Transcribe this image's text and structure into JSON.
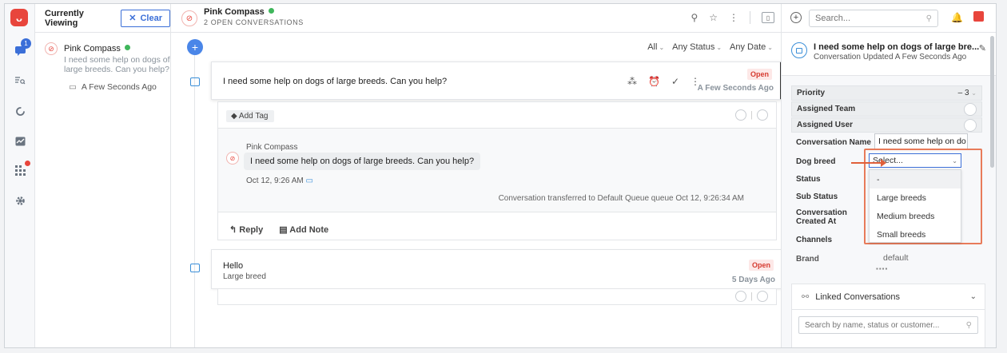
{
  "rail": {
    "badge_count": "1"
  },
  "viewing": {
    "title": "Currently Viewing",
    "clear_label": "Clear",
    "item": {
      "name": "Pink Compass",
      "preview": "I need some help on dogs of large breeds. Can you help?",
      "time": "A Few Seconds Ago"
    }
  },
  "center": {
    "title": "Pink Compass",
    "subtitle": "2 OPEN CONVERSATIONS",
    "filters": [
      "All",
      "Any Status",
      "Any Date"
    ],
    "conversation1": {
      "text": "I need some help on dogs of large breeds. Can you help?",
      "status": "Open",
      "time": "A Few Seconds Ago",
      "tag_label": "Add Tag",
      "sender": "Pink Compass",
      "message": "I need some help on dogs of large breeds. Can you help?",
      "message_time": "Oct 12, 9:26 AM",
      "transfer_note": "Conversation transferred to Default Queue queue Oct 12, 9:26:34 AM",
      "reply_label": "Reply",
      "note_label": "Add Note"
    },
    "conversation2": {
      "title": "Hello",
      "subtitle": "Large breed",
      "status": "Open",
      "time": "5 Days Ago"
    }
  },
  "right": {
    "search_placeholder": "Search...",
    "convo": {
      "title": "I need some help on dogs of large bre...",
      "subtitle": "Conversation Updated A Few Seconds Ago"
    },
    "properties": {
      "priority_label": "Priority",
      "priority_value": "–  3",
      "assigned_team_label": "Assigned Team",
      "assigned_user_label": "Assigned User",
      "conversation_name_label": "Conversation Name",
      "conversation_name_value": "I need some help on do",
      "dog_breed_label": "Dog breed",
      "dog_breed_placeholder": "Select...",
      "status_label": "Status",
      "sub_status_label": "Sub Status",
      "created_label": "Conversation Created At",
      "channels_label": "Channels",
      "brand_label": "Brand",
      "brand_value": "default"
    },
    "dog_breed_options": [
      "-",
      "Large breeds",
      "Medium breeds",
      "Small breeds"
    ],
    "linked": {
      "title": "Linked Conversations",
      "search_placeholder": "Search by name, status or customer..."
    }
  },
  "colors": {
    "accent": "#3b6fd8",
    "danger": "#e8453c",
    "online": "#3fb65b",
    "highlight": "#e87b5a"
  }
}
